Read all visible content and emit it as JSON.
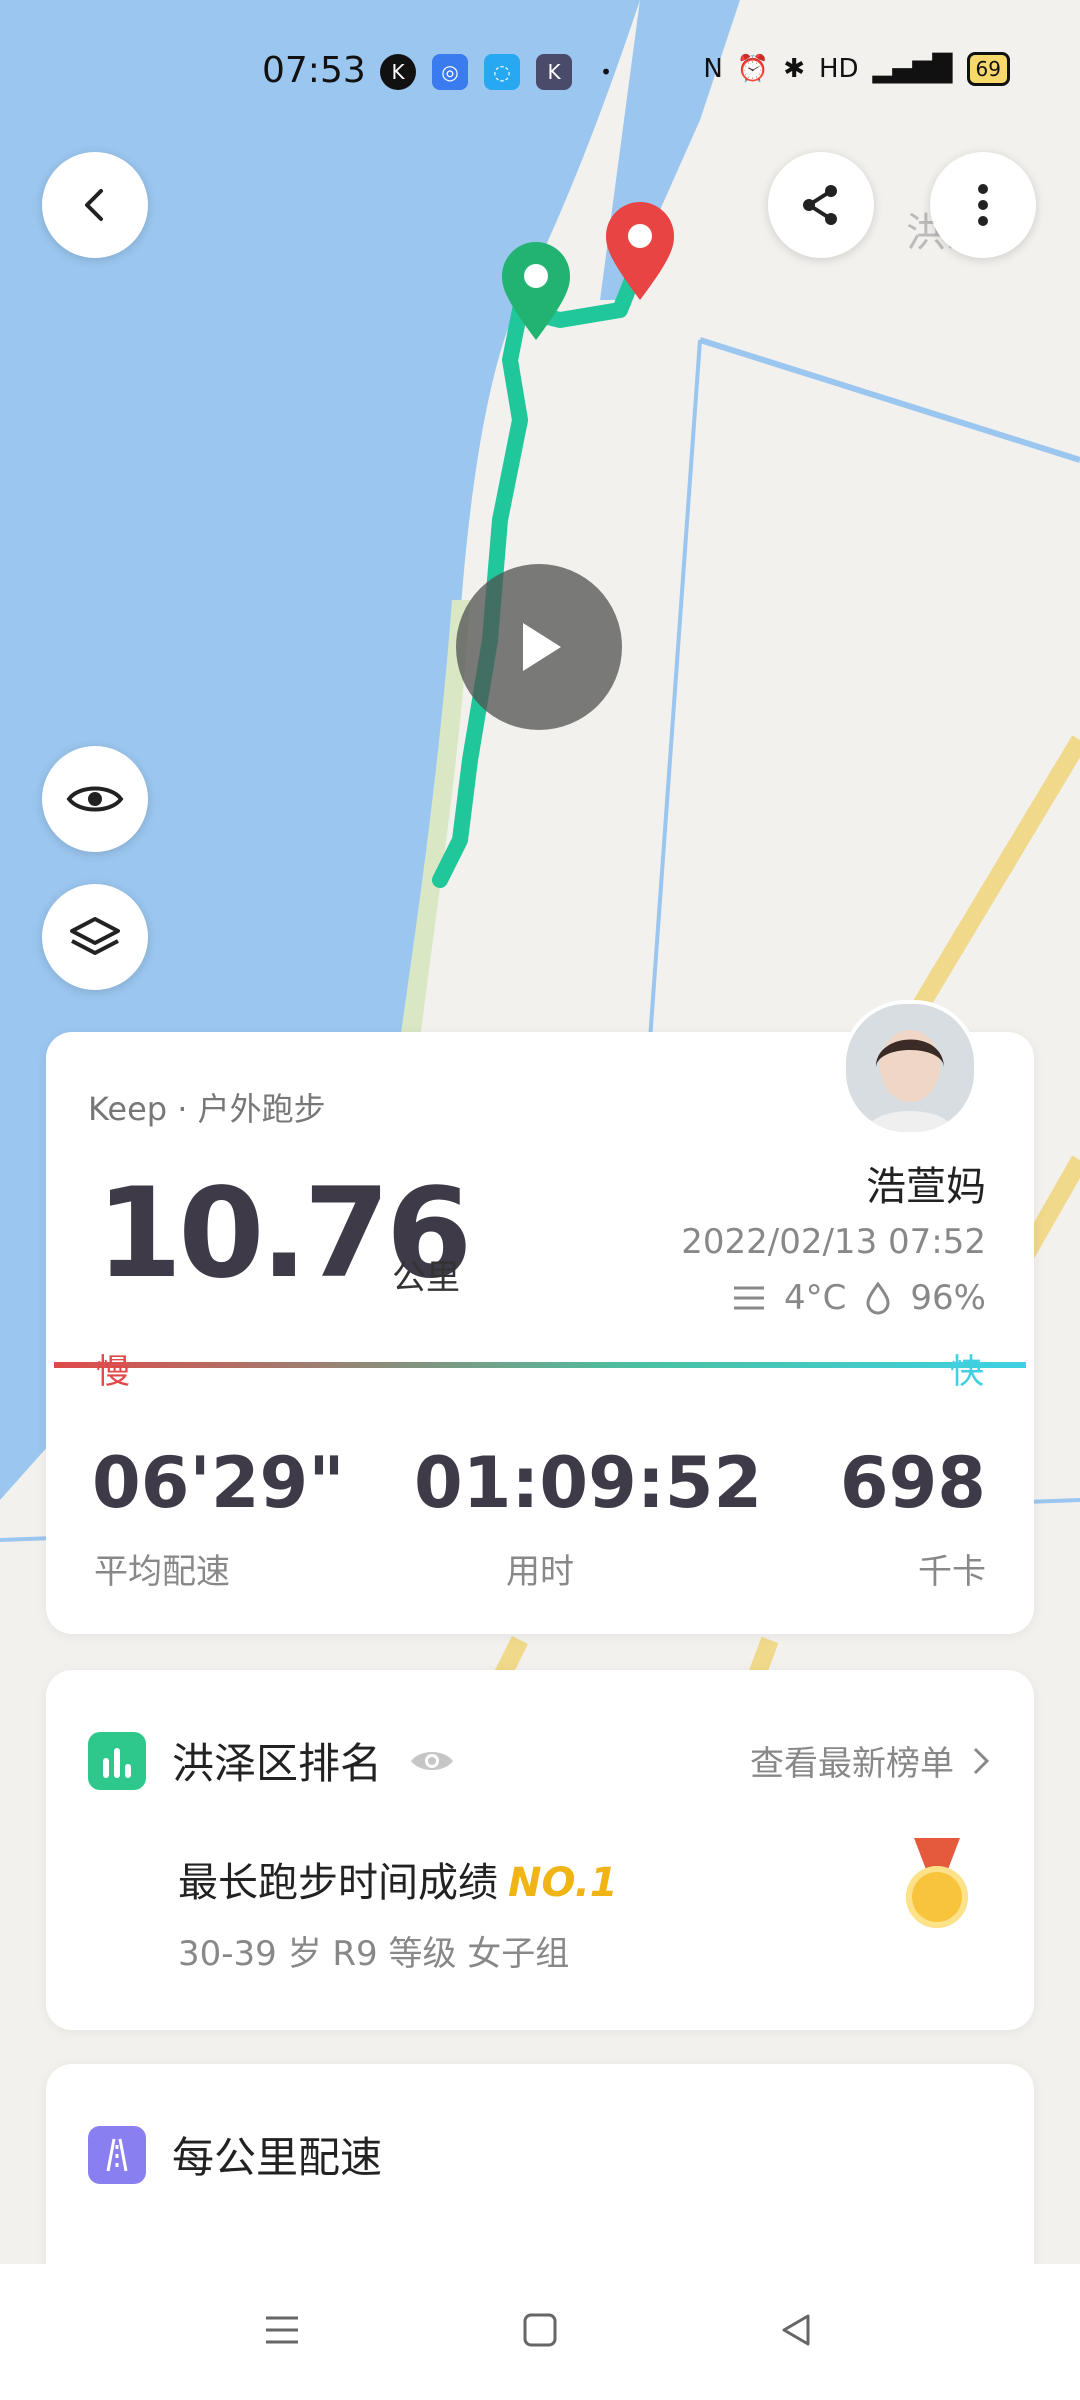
{
  "status_bar": {
    "time": "07:53",
    "battery": "69"
  },
  "map": {
    "brand": "洪泽"
  },
  "summary": {
    "app_label": "Keep · 户外跑步",
    "distance": "10.76",
    "unit": "公里",
    "user_name": "浩萱妈",
    "datetime": "2022/02/13 07:52",
    "temperature": "4°C",
    "humidity": "96%",
    "slow_label": "慢",
    "fast_label": "快",
    "stats": [
      {
        "value": "06'29\"",
        "label": "平均配速"
      },
      {
        "value": "01:09:52",
        "label": "用时"
      },
      {
        "value": "698",
        "label": "千卡"
      }
    ]
  },
  "ranking": {
    "title": "洪泽区排名",
    "view_list": "查看最新榜单",
    "achievement": "最长跑步时间成绩",
    "rank": "NO.1",
    "group": "30-39 岁 R9 等级 女子组"
  },
  "pace": {
    "title": "每公里配速"
  },
  "colors": {
    "accent_green": "#2fc88c",
    "route": "#1fc79a",
    "pin_red": "#e84444",
    "pin_green": "#22b373"
  }
}
